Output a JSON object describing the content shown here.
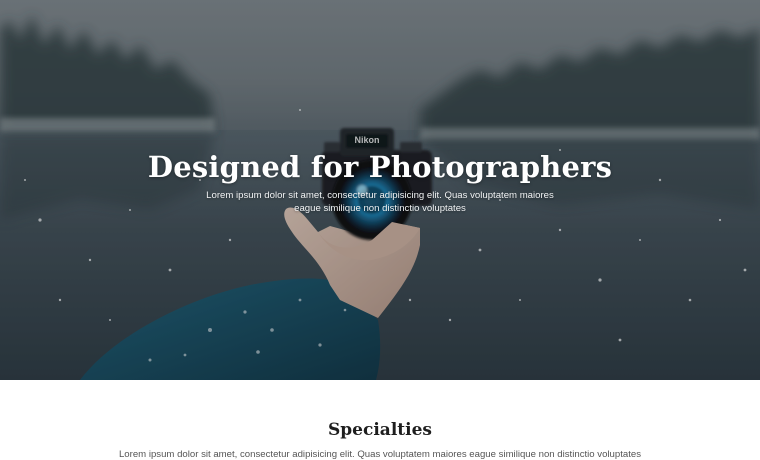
{
  "hero": {
    "title": "Designed for Photographers",
    "subtitle": "Lorem ipsum dolor sit amet, consectetur adipisicing elit. Quas voluptatem maiores eague similique non distinctio voluptates",
    "camera_brand": "Nikon",
    "image_subject": "hand-holding-camera-over-snowy-lake"
  },
  "specialties": {
    "title": "Specialties",
    "text": "Lorem ipsum dolor sit amet, consectetur adipisicing elit. Quas voluptatem maiores eague similique non distinctio voluptates"
  },
  "colors": {
    "hero_dark": "#2e3b43",
    "heading": "#1e1e1e",
    "body_text": "#555555",
    "background": "#ffffff"
  }
}
